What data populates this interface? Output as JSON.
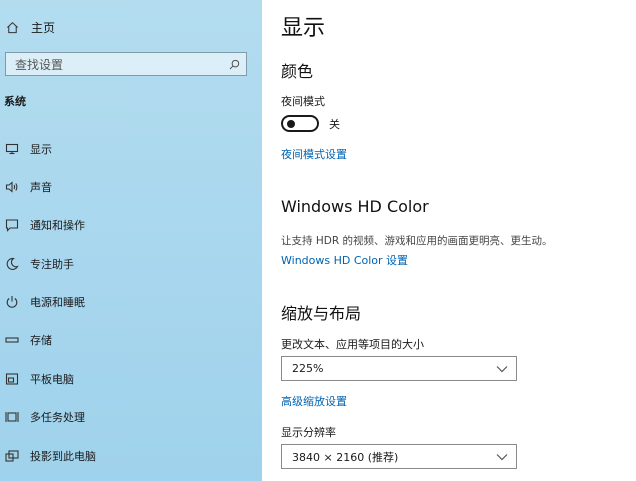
{
  "sidebar": {
    "home_label": "主页",
    "search_placeholder": "查找设置",
    "section_label": "系统",
    "items": [
      {
        "label": "显示",
        "icon": "monitor-icon"
      },
      {
        "label": "声音",
        "icon": "speaker-icon"
      },
      {
        "label": "通知和操作",
        "icon": "notification-icon"
      },
      {
        "label": "专注助手",
        "icon": "moon-icon"
      },
      {
        "label": "电源和睡眠",
        "icon": "power-icon"
      },
      {
        "label": "存储",
        "icon": "storage-icon"
      },
      {
        "label": "平板电脑",
        "icon": "tablet-icon"
      },
      {
        "label": "多任务处理",
        "icon": "multitask-icon"
      },
      {
        "label": "投影到此电脑",
        "icon": "project-icon"
      }
    ]
  },
  "main": {
    "title": "显示",
    "color_section": {
      "heading": "颜色",
      "night_mode_label": "夜间模式",
      "toggle_state": "关",
      "night_mode_link": "夜间模式设置"
    },
    "hd_section": {
      "heading": "Windows HD Color",
      "description": "让支持 HDR 的视频、游戏和应用的画面更明亮、更生动。",
      "link": "Windows HD Color 设置"
    },
    "scale_section": {
      "heading": "缩放与布局",
      "scale_label": "更改文本、应用等项目的大小",
      "scale_value": "225%",
      "advanced_link": "高级缩放设置",
      "resolution_label": "显示分辨率",
      "resolution_value": "3840 × 2160 (推荐)"
    }
  },
  "colors": {
    "sidebar_bg": "#a9d7ee",
    "link": "#0063b1"
  }
}
